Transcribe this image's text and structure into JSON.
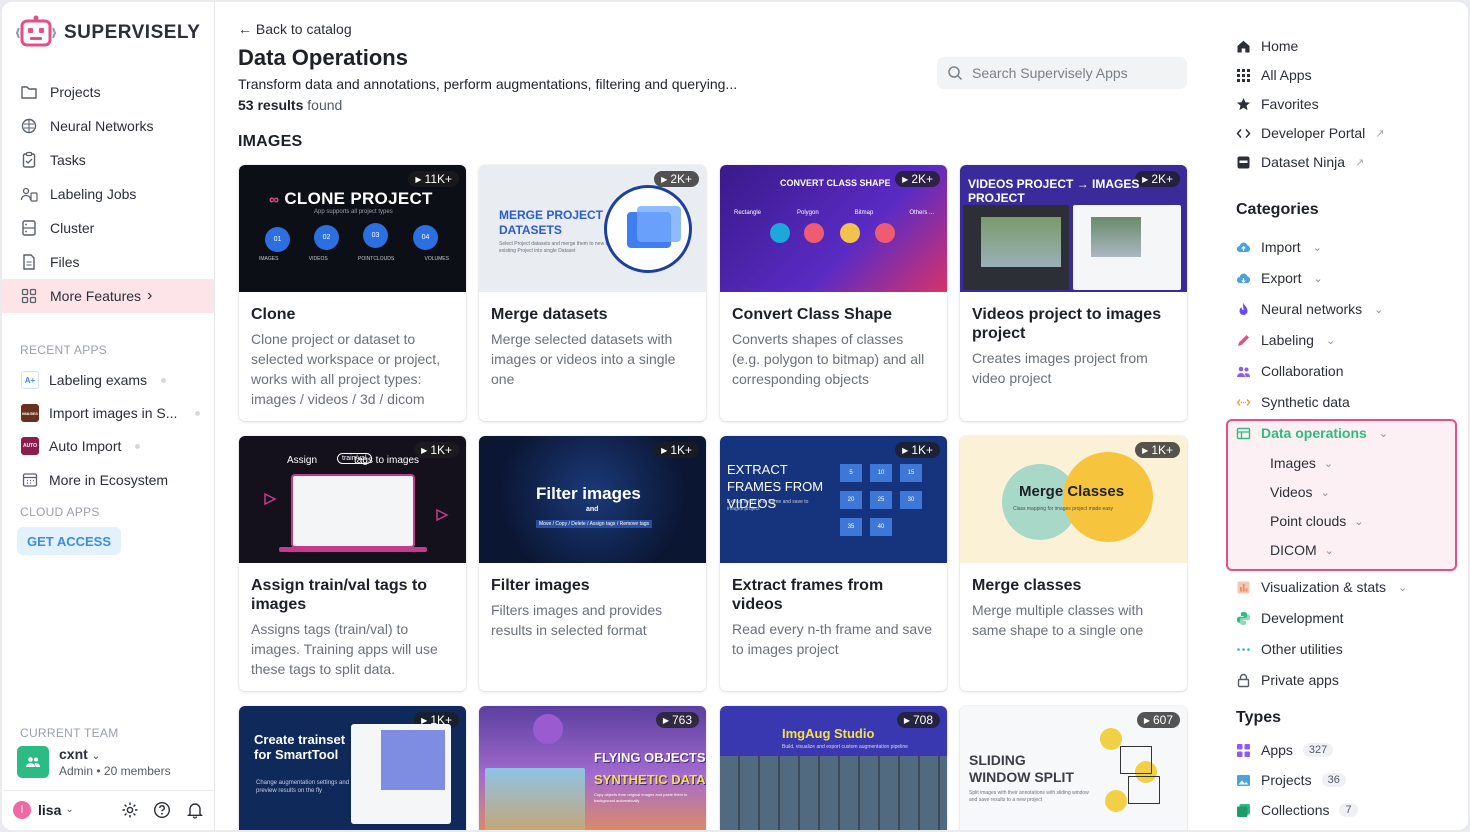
{
  "brand": {
    "name": "SUPERVISELY",
    "accent": "#e64f85"
  },
  "sidebar": {
    "nav": [
      {
        "label": "Projects",
        "icon": "folder-icon"
      },
      {
        "label": "Neural Networks",
        "icon": "brain-icon"
      },
      {
        "label": "Tasks",
        "icon": "clipboard-icon"
      },
      {
        "label": "Labeling Jobs",
        "icon": "users-icon"
      },
      {
        "label": "Cluster",
        "icon": "server-icon"
      },
      {
        "label": "Files",
        "icon": "file-icon"
      },
      {
        "label": "More Features",
        "icon": "grid-icon"
      }
    ],
    "more_features_chevron": "›",
    "recent_label": "RECENT APPS",
    "recent": [
      {
        "label": "Labeling exams",
        "thumb": "A+"
      },
      {
        "label": "Import images in S...",
        "thumb": "IMAGES"
      },
      {
        "label": "Auto Import",
        "thumb": "AUTO"
      },
      {
        "label": "More in Ecosystem",
        "thumb": ""
      }
    ],
    "cloud_label": "CLOUD APPS",
    "get_access": "GET ACCESS",
    "team_label": "CURRENT TEAM",
    "team_name": "cxnt",
    "team_role": "Admin",
    "team_members": "20 members",
    "user_initial": "l",
    "user_name": "lisa"
  },
  "main": {
    "back": "← Back to catalog",
    "title": "Data Operations",
    "description": "Transform data and annotations, perform augmentations, filtering and querying...",
    "results_count": "53 results",
    "results_suffix": "found",
    "search_placeholder": "Search Supervisely Apps",
    "section": "IMAGES",
    "cards": [
      {
        "title": "Clone",
        "desc": "Clone project or dataset to selected workspace or project, works with all project types: images / videos / 3d / dicom",
        "badge": "11K+",
        "thumb_title": "CLONE PROJECT",
        "thumb_sub": "App supports all project types",
        "thumb_items": [
          "01",
          "02",
          "03",
          "04"
        ],
        "thumb_labels": [
          "IMAGES",
          "VIDEOS",
          "POINTCLOUDS",
          "VOLUMES"
        ]
      },
      {
        "title": "Merge datasets",
        "desc": "Merge selected datasets with images or videos into a single one",
        "badge": "2K+",
        "thumb_title": "MERGE PROJECT DATASETS",
        "thumb_sub": "Select Project datasets and merge them to new or existing Project into single Dataset"
      },
      {
        "title": "Convert Class Shape",
        "desc": "Converts shapes of classes (e.g. polygon to bitmap) and all corresponding objects",
        "badge": "2K+",
        "thumb_title": "CONVERT CLASS SHAPE",
        "thumb_items": [
          "Rectangle",
          "Polygon",
          "Bitmap",
          "Others ..."
        ]
      },
      {
        "title": "Videos project to images project",
        "desc": "Creates images project from video project",
        "badge": "2K+",
        "thumb_title": "VIDEOS PROJECT → IMAGES PROJECT"
      },
      {
        "title": "Assign train/val tags to images",
        "desc": "Assigns tags (train/val) to images. Training apps will use these tags to split data.",
        "badge": "1K+",
        "thumb_title": "Assign",
        "thumb_sub": "tags to images",
        "thumb_tag": "train/val"
      },
      {
        "title": "Filter images",
        "desc": "Filters images and provides results in selected format",
        "badge": "1K+",
        "thumb_title": "Filter images",
        "thumb_sub": "and",
        "thumb_ops": "Move / Copy / Delete / Assign tags / Remove tags"
      },
      {
        "title": "Extract frames from videos",
        "desc": "Read every n-th frame and save to images project",
        "badge": "1K+",
        "thumb_title": "EXTRACT FRAMES FROM VIDEOS",
        "thumb_sub": "Extract every N-th frame and save to images project",
        "thumb_items": [
          "5",
          "10",
          "15",
          "20",
          "25",
          "30",
          "35",
          "40"
        ]
      },
      {
        "title": "Merge classes",
        "desc": "Merge multiple classes with same shape to a single one",
        "badge": "1K+",
        "thumb_title": "Merge Classes",
        "thumb_sub": "Class mapping for images project made easy"
      },
      {
        "title": "Create trainset for SmartTool",
        "desc": "",
        "badge": "1K+",
        "thumb_title": "Create trainset for SmartTool",
        "thumb_sub": "Change augmentation settings and preview results on the fly"
      },
      {
        "title": "Flying objects",
        "desc": "",
        "badge": "763",
        "thumb_title": "FLYING OBJECTS",
        "thumb_sub": "SYNTHETIC DATA",
        "thumb_note": "Copy objects from original images and paste them to background automatically"
      },
      {
        "title": "ImgAug Studio",
        "desc": "",
        "badge": "708",
        "thumb_title": "ImgAug Studio",
        "thumb_sub": "Build, visualize and export custom augmentation pipeline"
      },
      {
        "title": "Sliding window split",
        "desc": "",
        "badge": "607",
        "thumb_title": "SLIDING WINDOW SPLIT",
        "thumb_sub": "Split images with their annotations with sliding window and save results to a new project"
      }
    ]
  },
  "right": {
    "top_links": [
      {
        "label": "Home",
        "icon": "home-icon"
      },
      {
        "label": "All Apps",
        "icon": "apps-grid-icon"
      },
      {
        "label": "Favorites",
        "icon": "star-icon"
      },
      {
        "label": "Developer Portal",
        "icon": "code-icon",
        "external": true
      },
      {
        "label": "Dataset Ninja",
        "icon": "ninja-icon",
        "external": true
      }
    ],
    "categories_title": "Categories",
    "categories": [
      {
        "label": "Import",
        "icon": "cloud-upload-icon",
        "color": "#4aa3df",
        "chevron": true
      },
      {
        "label": "Export",
        "icon": "cloud-download-icon",
        "color": "#4aa3df",
        "chevron": true
      },
      {
        "label": "Neural networks",
        "icon": "flame-icon",
        "color": "#6c4cf0",
        "chevron": true
      },
      {
        "label": "Labeling",
        "icon": "pencil-icon",
        "color": "#e64f85",
        "chevron": true
      },
      {
        "label": "Collaboration",
        "icon": "people-icon",
        "color": "#8d5cf6",
        "chevron": false
      },
      {
        "label": "Synthetic data",
        "icon": "arrows-icon",
        "color": "#f0a030",
        "chevron": false
      },
      {
        "label": "Data operations",
        "icon": "table-icon",
        "color": "#2dbb84",
        "chevron": true
      },
      {
        "label": "Visualization & stats",
        "icon": "bar-chart-icon",
        "color": "#f08a5d",
        "chevron": true
      },
      {
        "label": "Development",
        "icon": "python-icon",
        "color": "#2dbb84",
        "chevron": false
      },
      {
        "label": "Other utilities",
        "icon": "dots-icon",
        "color": "#4aa3df",
        "chevron": false
      },
      {
        "label": "Private apps",
        "icon": "lock-icon",
        "color": "#555b63",
        "chevron": false
      }
    ],
    "data_ops_sub": [
      "Images",
      "Videos",
      "Point clouds",
      "DICOM"
    ],
    "types_title": "Types",
    "types": [
      {
        "label": "Apps",
        "count": "327",
        "icon": "apps-icon",
        "color": "#8d5cf6"
      },
      {
        "label": "Projects",
        "count": "36",
        "icon": "image-icon",
        "color": "#4aa3df"
      },
      {
        "label": "Collections",
        "count": "7",
        "icon": "collection-icon",
        "color": "#2dbb84"
      }
    ]
  }
}
